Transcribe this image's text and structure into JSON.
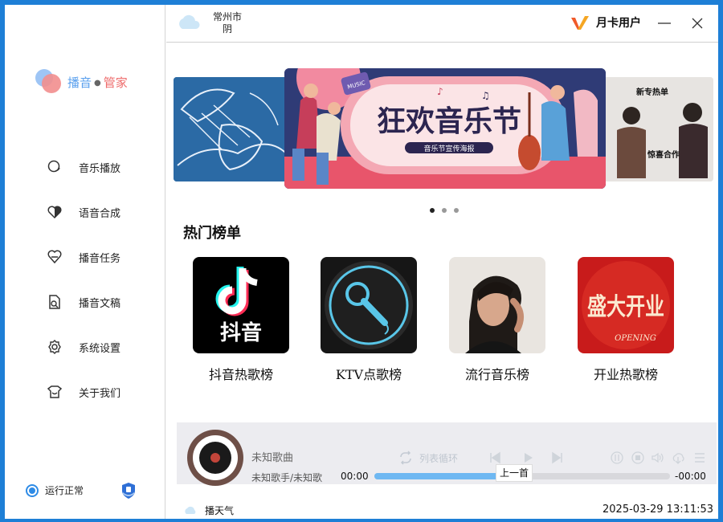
{
  "brand": {
    "part1": "播音",
    "separator": "●",
    "part2": "管家"
  },
  "nav": [
    {
      "label": "音乐播放",
      "icon": "music-play-icon"
    },
    {
      "label": "语音合成",
      "icon": "voice-synthesis-icon"
    },
    {
      "label": "播音任务",
      "icon": "broadcast-task-icon"
    },
    {
      "label": "播音文稿",
      "icon": "broadcast-script-icon"
    },
    {
      "label": "系统设置",
      "icon": "settings-gear-icon"
    },
    {
      "label": "关于我们",
      "icon": "about-us-icon"
    }
  ],
  "status": {
    "label": "运行正常"
  },
  "header": {
    "city": "常州市",
    "weather": "阴",
    "user_label": "月卡用户",
    "min_icon": "minimize-icon",
    "close_icon": "close-icon"
  },
  "carousel": {
    "main_title": "狂欢音乐节",
    "main_subtitle": "音乐节宣传海报",
    "main_badge": "MUSIC",
    "right_tag": "新专热单",
    "right_caption": "惊喜合作",
    "active_index": 0,
    "count": 3
  },
  "charts": {
    "title": "热门榜单",
    "items": [
      {
        "name": "抖音热歌榜",
        "cover_text": "抖音"
      },
      {
        "name": "KTV点歌榜"
      },
      {
        "name": "流行音乐榜"
      },
      {
        "name": "开业热歌榜",
        "cover_text": "盛大开业",
        "cover_sub": "OPENING"
      }
    ]
  },
  "player": {
    "song": "未知歌曲",
    "artist": "未知歌手/未知歌",
    "loop_mode": "列表循环",
    "time_current": "00:00",
    "time_total": "-00:00",
    "progress": 0.42,
    "tooltip": "上一首"
  },
  "footer": {
    "weather_label": "播天气",
    "datetime": "2025-03-29 13:11:53"
  },
  "colors": {
    "frame": "#1e7fd6",
    "accent": "#2e8be6",
    "progress": "#6fb8f2"
  }
}
